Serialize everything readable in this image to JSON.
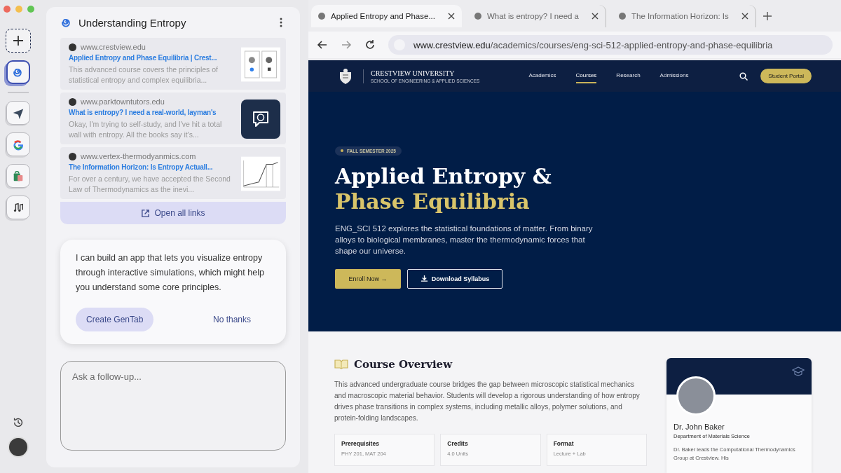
{
  "rail": {
    "apps": [
      {
        "kind": "spiral",
        "selected": true
      },
      {
        "kind": "plane",
        "selected": false
      },
      {
        "kind": "google",
        "selected": false
      },
      {
        "kind": "bag",
        "selected": false
      },
      {
        "kind": "music",
        "selected": false
      }
    ]
  },
  "panel": {
    "title": "Understanding Entropy",
    "results": [
      {
        "domain": "www.crestview.edu",
        "title": "Applied Entropy and Phase Equilibria | Crest...",
        "snippet": "This advanced course covers the principles of statistical entropy and complex equilibria...",
        "kind": "diagram"
      },
      {
        "domain": "www.parktowntutors.edu",
        "title": "What is entropy? I need a real-world, layman's",
        "snippet": "Okay, I'm trying to self-study, and I've hit a total wall with entropy. All the books say it's...",
        "kind": "logo"
      },
      {
        "domain": "www.vertex-thermodyanmics.com",
        "title": "The Information Horizon: Is Entropy Actuall...",
        "snippet": "For over a century, we have accepted the Second Law of Thermodynamics as the inevi...",
        "kind": "graph"
      }
    ],
    "open_all": "Open all links",
    "suggestion": {
      "text": "I can build an app that lets you visualize entropy through interactive simulations, which might help you understand some core principles.",
      "primary": "Create GenTab",
      "secondary": "No thanks"
    },
    "followup": {
      "placeholder": "Ask a follow-up..."
    }
  },
  "browser": {
    "tabs": [
      {
        "title": "Applied Entropy and Phase...",
        "selected": true
      },
      {
        "title": "What is entropy? I need a",
        "selected": false
      },
      {
        "title": "The Information Horizon: Is",
        "selected": false
      }
    ],
    "url": {
      "host": "www.crestview.edu",
      "path": "/academics/courses/eng-sci-512-applied-entropy-and-phase-equilibria"
    }
  },
  "site": {
    "brand": "CRESTVIEW UNIVERSITY",
    "brand_sub": "SCHOOL OF ENGINEERING & APPLIED SCIENCES",
    "nav": [
      {
        "label": "Academics",
        "selected": false
      },
      {
        "label": "Courses",
        "selected": true
      },
      {
        "label": "Research",
        "selected": false
      },
      {
        "label": "Admissions",
        "selected": false
      }
    ],
    "portal": "Student Portal",
    "hero": {
      "badge": "FALL SEMESTER 2025",
      "title_1": "Applied Entropy &",
      "title_2": "Phase Equilibria",
      "lead": "ENG_SCI 512 explores the statistical foundations of matter. From binary alloys to biological membranes, master the thermodynamic forces that shape our universe.",
      "enroll": "Enroll Now",
      "enroll_arrow": "→",
      "download": "Download Syllabus"
    },
    "overview": {
      "heading": "Course Overview",
      "body": "This advanced undergraduate course bridges the gap between microscopic statistical mechanics and macroscopic material behavior. Students will develop a rigorous understanding of how entropy drives phase transitions in complex systems, including metallic alloys, polymer solutions, and protein-folding landscapes.",
      "facts": [
        {
          "label": "Prerequisites",
          "value": "PHY 201, MAT 204"
        },
        {
          "label": "Credits",
          "value": "4.0 Units"
        },
        {
          "label": "Format",
          "value": "Lecture + Lab"
        }
      ]
    },
    "instructor": {
      "name": "Dr. John Baker",
      "dept": "Department of Materials Science",
      "bio": "Dr. Baker leads the Computational Thermodynamics Group at Crestview. His"
    }
  }
}
